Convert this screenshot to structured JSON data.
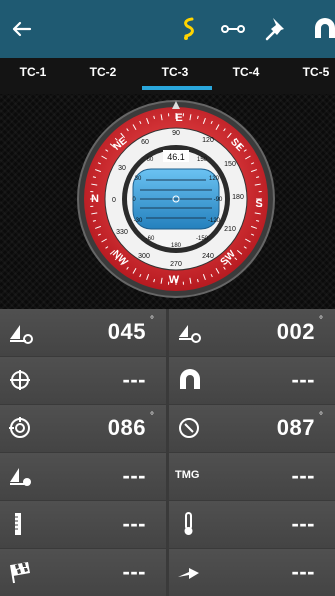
{
  "header": {
    "back_icon": "arrow-left-icon",
    "actions": [
      "route-icon",
      "waypoint-line-icon",
      "pin-icon",
      "magnet-icon"
    ]
  },
  "tabs": [
    "TC-1",
    "TC-2",
    "TC-3",
    "TC-4",
    "TC-5"
  ],
  "active_tab": "TC-3",
  "compass": {
    "cardinals": {
      "n": "N",
      "e": "E",
      "s": "S",
      "w": "W",
      "ne": "NE",
      "se": "SE",
      "sw": "SW",
      "nw": "NW"
    },
    "inner_value": "46.1",
    "ring_labels": [
      "0",
      "30",
      "60",
      "90",
      "120",
      "150",
      "180",
      "210",
      "240",
      "270",
      "300",
      "330"
    ],
    "inner_ring_labels": [
      "60",
      "30",
      "0",
      "-30",
      "-60",
      "-90",
      "-120",
      "-150",
      "180",
      "150",
      "120",
      "90"
    ]
  },
  "cells": [
    {
      "icon": "boat-course-icon",
      "value": "045",
      "deg": "°"
    },
    {
      "icon": "boat-target-icon",
      "value": "002",
      "deg": "°"
    },
    {
      "icon": "crosshair-icon",
      "value": "---",
      "deg": ""
    },
    {
      "icon": "magnet-icon",
      "value": "---",
      "deg": ""
    },
    {
      "icon": "target-icon",
      "value": "086",
      "deg": "°"
    },
    {
      "icon": "compass-dial-icon",
      "value": "087",
      "deg": "°"
    },
    {
      "icon": "boat-alert-icon",
      "value": "---",
      "deg": ""
    },
    {
      "icon": "",
      "text": "TMG",
      "value": "---",
      "deg": ""
    },
    {
      "icon": "ruler-icon",
      "value": "---",
      "deg": ""
    },
    {
      "icon": "thermometer-icon",
      "value": "---",
      "deg": ""
    },
    {
      "icon": "finish-flag-icon",
      "value": "---",
      "deg": ""
    },
    {
      "icon": "arrow-right-icon",
      "value": "---",
      "deg": ""
    }
  ],
  "colors": {
    "header": "#1f5a72",
    "tab_indicator": "#2aa7dc",
    "bezel_red": "#d4232b",
    "dial_blue": "#3a9fd8"
  }
}
